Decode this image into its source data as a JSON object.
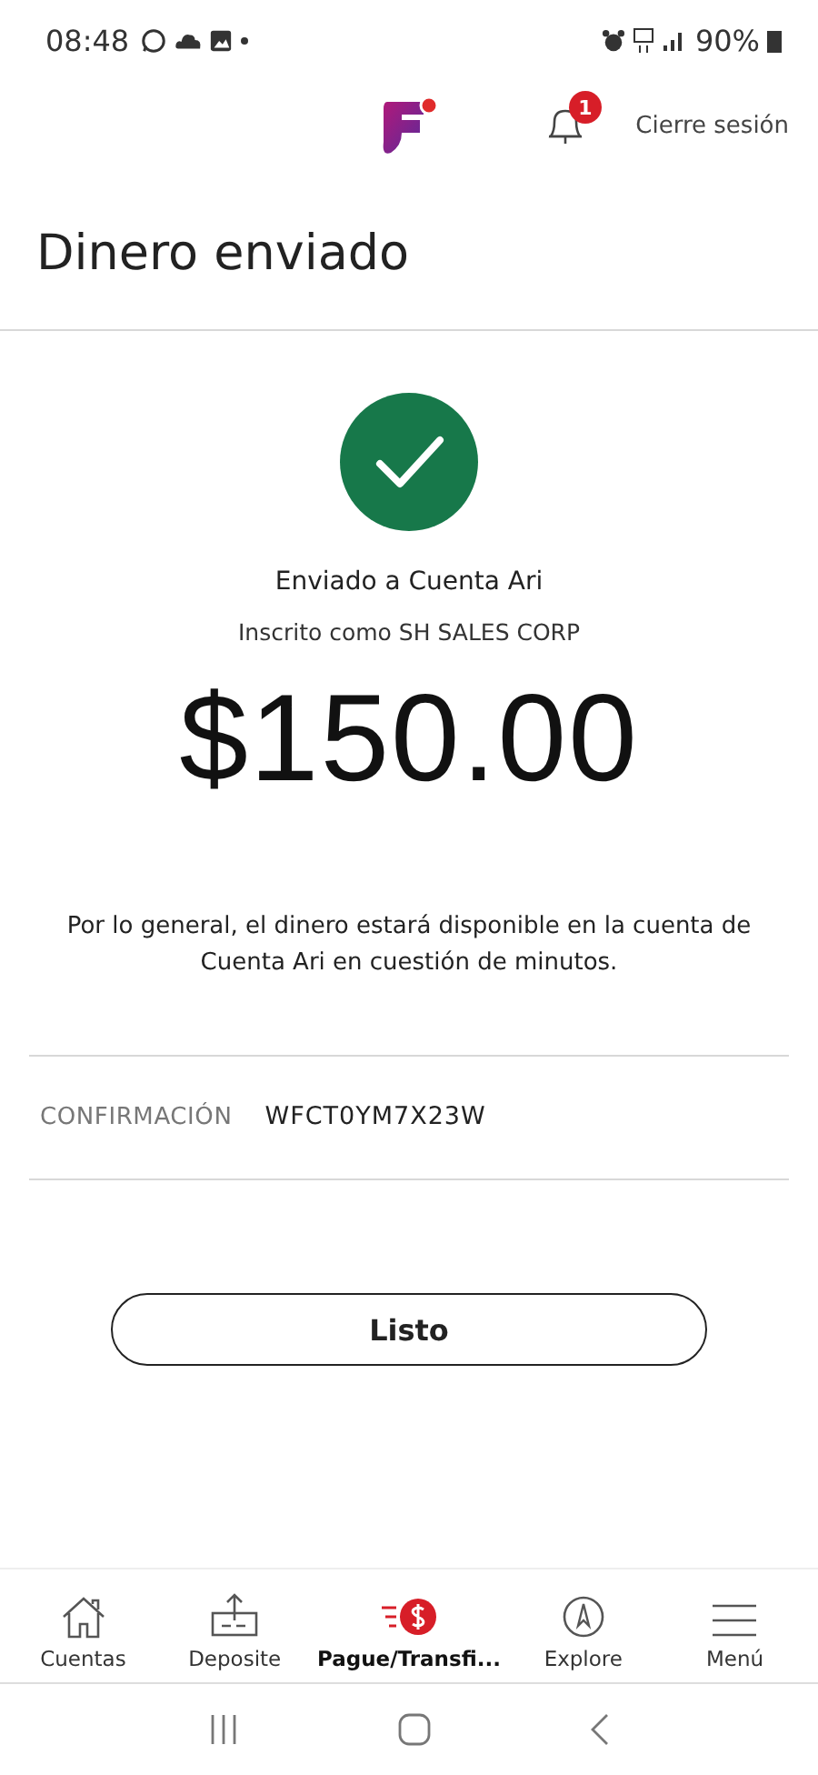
{
  "status_bar": {
    "time": "08:48",
    "battery": "90%"
  },
  "header": {
    "badge": "1",
    "logout": "Cierre sesión"
  },
  "title": "Dinero enviado",
  "recipient": "Enviado a Cuenta Ari",
  "registered_as": "Inscrito como SH SALES CORP",
  "amount": "$150.00",
  "note": "Por lo general, el dinero estará disponible en la cuenta de Cuenta Ari en cuestión de minutos.",
  "confirmation": {
    "label": "CONFIRMACIÓN",
    "value": "WFCT0YM7X23W"
  },
  "done_button": "Listo",
  "nav": [
    {
      "kind": "home",
      "label": "Cuentas",
      "selected": false
    },
    {
      "kind": "deposit",
      "label": "Deposite",
      "selected": false
    },
    {
      "kind": "pay",
      "label": "Pague/Transfi...",
      "selected": true
    },
    {
      "kind": "explore",
      "label": "Explore",
      "selected": false
    },
    {
      "kind": "menu",
      "label": "Menú",
      "selected": false
    }
  ]
}
